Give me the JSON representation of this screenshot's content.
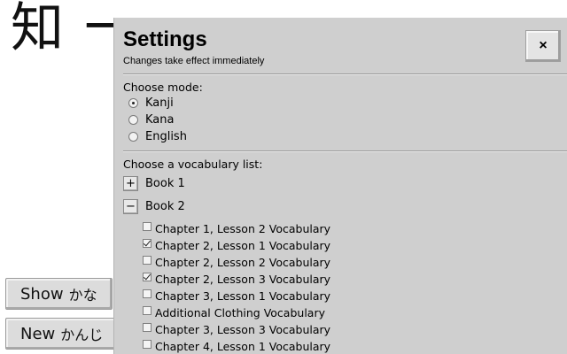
{
  "background": {
    "kanji_text": "知 一",
    "show_button": {
      "label": "Show",
      "label_jp": "かな"
    },
    "new_button": {
      "label": "New",
      "label_jp": "かんじ"
    }
  },
  "settings": {
    "title": "Settings",
    "subtitle": "Changes take effect immediately",
    "close_label": "×",
    "mode": {
      "label": "Choose mode:",
      "options": [
        {
          "label": "Kanji",
          "selected": true
        },
        {
          "label": "Kana",
          "selected": false
        },
        {
          "label": "English",
          "selected": false
        }
      ]
    },
    "vocab": {
      "label": "Choose a vocabulary list:",
      "books": [
        {
          "label": "Book 1",
          "toggle": "+",
          "expanded": false
        },
        {
          "label": "Book 2",
          "toggle": "−",
          "expanded": true
        }
      ],
      "lessons": [
        {
          "label": "Chapter 1, Lesson 2 Vocabulary",
          "checked": false
        },
        {
          "label": "Chapter 2, Lesson 1 Vocabulary",
          "checked": true
        },
        {
          "label": "Chapter 2, Lesson 2 Vocabulary",
          "checked": false
        },
        {
          "label": "Chapter 2, Lesson 3 Vocabulary",
          "checked": true
        },
        {
          "label": "Chapter 3, Lesson 1 Vocabulary",
          "checked": false
        },
        {
          "label": "Additional Clothing Vocabulary",
          "checked": false
        },
        {
          "label": "Chapter 3, Lesson 3 Vocabulary",
          "checked": false
        },
        {
          "label": "Chapter 4, Lesson 1 Vocabulary",
          "checked": false
        }
      ]
    }
  }
}
